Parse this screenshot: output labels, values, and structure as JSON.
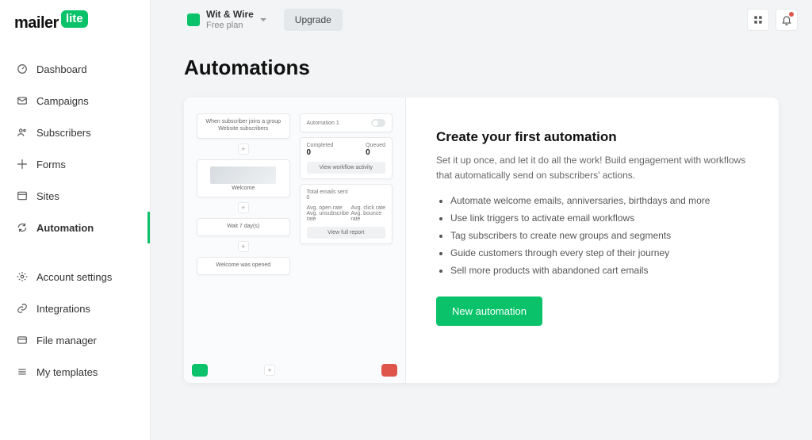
{
  "brand": {
    "word": "mailer",
    "badge": "lite"
  },
  "nav": {
    "primary": [
      {
        "id": "dashboard",
        "label": "Dashboard",
        "icon": "gauge-icon"
      },
      {
        "id": "campaigns",
        "label": "Campaigns",
        "icon": "mail-icon"
      },
      {
        "id": "subscribers",
        "label": "Subscribers",
        "icon": "users-icon"
      },
      {
        "id": "forms",
        "label": "Forms",
        "icon": "sparkle-icon"
      },
      {
        "id": "sites",
        "label": "Sites",
        "icon": "window-icon"
      },
      {
        "id": "automation",
        "label": "Automation",
        "icon": "refresh-icon",
        "active": true
      }
    ],
    "secondary": [
      {
        "id": "account",
        "label": "Account settings",
        "icon": "gear-icon"
      },
      {
        "id": "integrations",
        "label": "Integrations",
        "icon": "link-icon"
      },
      {
        "id": "filemanager",
        "label": "File manager",
        "icon": "folder-icon"
      },
      {
        "id": "templates",
        "label": "My templates",
        "icon": "stack-icon"
      }
    ]
  },
  "header": {
    "account_name": "Wit & Wire",
    "plan_label": "Free plan",
    "upgrade_label": "Upgrade"
  },
  "page_title": "Automations",
  "intro": {
    "heading": "Create your first automation",
    "body": "Set it up once, and let it do all the work! Build engagement with workflows that automatically send on subscribers' actions.",
    "bullets": [
      "Automate welcome emails, anniversaries, birthdays and more",
      "Use link triggers to activate email workflows",
      "Tag subscribers to create new groups and segments",
      "Guide customers through every step of their journey",
      "Sell more products with abandoned cart emails"
    ],
    "cta_label": "New automation"
  },
  "preview": {
    "trigger_text": "When subscriber joins a group Website subscribers",
    "step_welcome": "Welcome",
    "step_wait": "Wait 7 day(s)",
    "step_opened": "Welcome was opened",
    "pane_title": "Automation 1",
    "completed_label": "Completed",
    "queued_label": "Queued",
    "completed_val": "0",
    "queued_val": "0",
    "view_activity": "View workflow activity",
    "total_label": "Total emails sent",
    "total_val": "0",
    "open_rate": "Avg. open rate",
    "click_rate": "Avg. click rate",
    "unsub_rate": "Avg. unsubscribe rate",
    "bounce_rate": "Avg. bounce rate",
    "view_report": "View full report"
  }
}
